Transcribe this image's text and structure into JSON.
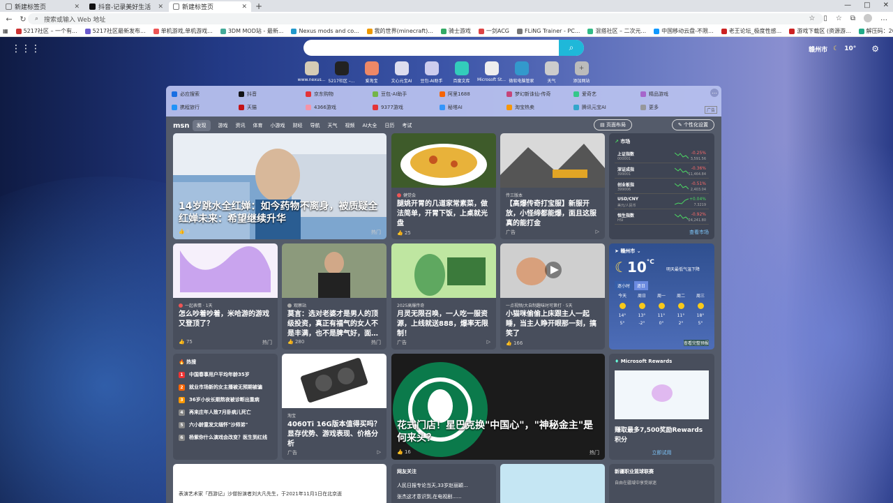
{
  "tabs": [
    {
      "label": "新建标签页",
      "active": false
    },
    {
      "label": "抖音-记录美好生活",
      "active": false
    },
    {
      "label": "新建标签页",
      "active": true
    }
  ],
  "window_controls": [
    "—",
    "□",
    "✕"
  ],
  "address": {
    "placeholder": "搜索或输入 Web 地址"
  },
  "bookmarks": [
    "5217社区 – 一个有...",
    "5217社区最新发布...",
    "单机游戏,单机游戏...",
    "3DM MOD站 - 最新...",
    "Nexus mods and co...",
    "我的世界(minecraft)...",
    "骑士游戏",
    "一剑ACG",
    "FLiNG Trainer - PC...",
    "混搭社区 – 二次元...",
    "中国移动云盘-不限...",
    "老王论坛_极度性感...",
    "游戏下载区 (资源游...",
    "解压码：2024 | VLink",
    "OpenRouter",
    "paydaiIbuster.com",
    "遇过 Torrent 免费下..."
  ],
  "top_weather": {
    "city": "赣州市",
    "temp": "10°"
  },
  "quick_links": [
    "www.nexus...",
    "5217社区 –...",
    "爱淘宝",
    "文心元宝AI",
    "豆包-AI助手",
    "百度文库",
    "Microsoft St...",
    "微软电脑管家",
    "天气",
    "添加网站"
  ],
  "links_row1": [
    "必应搜索",
    "抖音",
    "京东购物",
    "豆包-AI助手",
    "阿里1688",
    "梦幻新诛仙-传奇",
    "爱奇艺",
    "精品游戏"
  ],
  "links_row2": [
    "携程旅行",
    "天猫",
    "4366游戏",
    "9377游戏",
    "秘塔AI",
    "淘宝热卖",
    "腾讯元宝AI",
    "更多"
  ],
  "links_ad": "广告",
  "feed_nav": {
    "logo": "msn",
    "items": [
      "发现",
      "游戏",
      "资讯",
      "体育",
      "小游戏",
      "财经",
      "导航",
      "天气",
      "视频",
      "AI大全",
      "日历",
      "考试"
    ],
    "btn1": "页面布局",
    "btn2": "个性化设置"
  },
  "cards": {
    "main": {
      "title": "14岁跳水全红婵：如今药物不离身，被质疑全红婵未来：希望继续升华",
      "likes": "8",
      "tag": "热门"
    },
    "food": {
      "source": "健觉会",
      "title": "腿姚开胃的几道家常素菜，做法简单，开胃下饭，上桌就光盘",
      "likes": "25"
    },
    "game_ad": {
      "source": "传三版本",
      "title": "【高爆传奇打宝服】新服开放，小怪缔都能爆，面且这服真的能打金",
      "ad": "广告"
    },
    "c1": {
      "source": "一起表情 · 1天",
      "title": "怎么吵着吵着，米哈游的游戏又登顶了？",
      "likes": "75",
      "tag": "热门"
    },
    "c2": {
      "source": "观察站",
      "title": "莫言：选对老婆才是男人的顶级投资，真正有福气的女人不是丰满，也不是脾气好，面…",
      "likes": "280",
      "tag": "热门"
    },
    "c3": {
      "source": "2025高爆传奇",
      "title": "月灵无限召唤，一人吃一服资源，上线就送888，爆率无限制！",
      "ad": "广告"
    },
    "c4": {
      "source": "一点视频/大自制趣味时可第打 · 5天",
      "title": "小猫咪偷偷上床跟主人一起睡，当主人睁开眼那一刻，搞笑了",
      "likes": "166"
    },
    "gpu": {
      "source": "淘宝",
      "title": "4060Ti 16G版本值得买吗？显存优势、游戏表现、价格分析",
      "ad": "广告"
    },
    "starbucks": {
      "source": "星巴克新闻",
      "title": "花式门店！星巴克换\"中国心\"，\"神秘金主\"是何来头？",
      "likes": "16",
      "tag": "热门"
    },
    "news_bottom": {
      "text": "表演艺术家「西游记」沙僧扮演者刘大凡先生，于2021年11月1日在北京逝"
    },
    "follow": {
      "title": "网友关注",
      "items": [
        "人民日报专论当天,33岁赵丽颖...",
        "张杰这才意识到,在电视剧......"
      ]
    },
    "bottom_right": {
      "title": "新疆职业篮球联赛",
      "sub": "自由在疆域中享受球迷"
    }
  },
  "market": {
    "title": "市场",
    "rows": [
      {
        "name": "上证指数",
        "code": "000001",
        "change": "-0.25%",
        "price": "3,591.56",
        "dir": "dn"
      },
      {
        "name": "深证成指",
        "code": "399001",
        "change": "-0.36%",
        "price": "11,464.84",
        "dir": "dn"
      },
      {
        "name": "创业板指",
        "code": "399006",
        "change": "-0.51%",
        "price": "2,403.04",
        "dir": "dn"
      },
      {
        "name": "USD/CNY",
        "code": "美元/人民币",
        "change": "+0.04%",
        "price": "7.3219",
        "dir": "up"
      },
      {
        "name": "恒生指数",
        "code": "HSI",
        "change": "-0.92%",
        "price": "24,241.80",
        "dir": "dn"
      }
    ],
    "more": "查看市场"
  },
  "weather": {
    "city": "赣州市",
    "temp": "10",
    "unit": "°C",
    "note": "明天最低气温下降",
    "tabs": [
      "逐小时",
      "逐日"
    ],
    "days": [
      {
        "d": "今天",
        "hi": "14°",
        "lo": "5°"
      },
      {
        "d": "周日",
        "hi": "13°",
        "lo": "-2°"
      },
      {
        "d": "周一",
        "hi": "11°",
        "lo": "0°"
      },
      {
        "d": "周二",
        "hi": "11°",
        "lo": "2°"
      },
      {
        "d": "周三",
        "hi": "18°",
        "lo": "5°"
      }
    ],
    "more": "查看完整预报"
  },
  "hot": {
    "title": "热搜",
    "items": [
      "中国春事用户平均年龄35岁",
      "就业市场新的女主播被无预期被骗",
      "36岁小伙长期熬夜被诊断出重病",
      "再来庄年人致7月卧病儿死亡",
      "六小龄童发文缅怀\"沙师弟\"",
      "杨紫你什么演戏会改变？医生到红线"
    ]
  },
  "rewards": {
    "title": "Microsoft Rewards",
    "text": "赚取最多7,500奖励Rewards积分",
    "link": "立即试用"
  }
}
